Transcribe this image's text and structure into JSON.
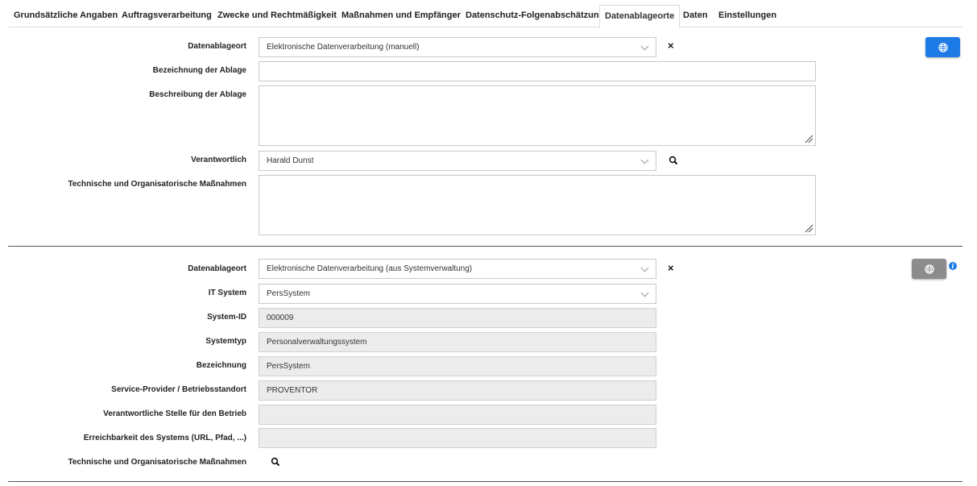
{
  "tabs": [
    {
      "label": "Grundsätzliche Angaben"
    },
    {
      "label": "Auftragsverarbeitung"
    },
    {
      "label": "Zwecke und Rechtmäßigkeit"
    },
    {
      "label": "Maßnahmen und Empfänger"
    },
    {
      "label": "Datenschutz-Folgenabschätzung"
    },
    {
      "label": "Datenablageorte"
    },
    {
      "label": "Daten"
    },
    {
      "label": "Einstellungen"
    }
  ],
  "active_tab": "Datenablageorte",
  "section1": {
    "ablageort_label": "Datenablageort",
    "ablageort_value": "Elektronische Datenverarbeitung (manuell)",
    "bezeichnung_label": "Bezeichnung der Ablage",
    "bezeichnung_value": "",
    "beschreibung_label": "Beschreibung der Ablage",
    "beschreibung_value": "",
    "verantwortlich_label": "Verantwortlich",
    "verantwortlich_value": "Harald Dunst",
    "tom_label": "Technische und Organisatorische Maßnahmen",
    "tom_value": "",
    "remove_symbol": "×"
  },
  "section2": {
    "ablageort_label": "Datenablageort",
    "ablageort_value": "Elektronische Datenverarbeitung (aus Systemverwaltung)",
    "it_system_label": "IT System",
    "it_system_value": "PersSystem",
    "system_id_label": "System-ID",
    "system_id_value": "000009",
    "systemtyp_label": "Systemtyp",
    "systemtyp_value": "Personalverwaltungssystem",
    "bezeichnung_label": "Bezeichnung",
    "bezeichnung_value": "PersSystem",
    "provider_label": "Service-Provider / Betriebsstandort",
    "provider_value": "PROVENTOR",
    "stelle_label": "Verantwortliche Stelle für den Betrieb",
    "stelle_value": "",
    "erreichbarkeit_label": "Erreichbarkeit des Systems (URL, Pfad, ...)",
    "erreichbarkeit_value": "",
    "tom_label": "Technische und Organisatorische Maßnahmen",
    "remove_symbol": "×",
    "info_symbol": "i"
  },
  "icons": {
    "globe": "globe-icon",
    "search": "search-icon",
    "chevron": "chevron-down-icon",
    "resize": "resize-grip-icon",
    "info": "info-icon"
  },
  "colors": {
    "accent_blue": "#1e7be6",
    "button_gray": "#8c8c8c",
    "readonly_bg": "#ececec"
  }
}
